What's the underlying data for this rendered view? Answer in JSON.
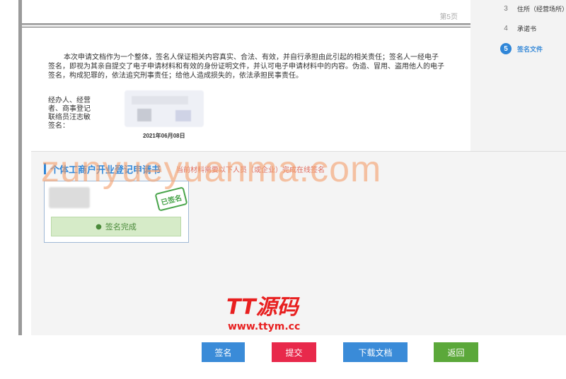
{
  "document": {
    "page_label": "第5页",
    "paragraph": "本次申请文档作为一个整体，签名人保证相关内容真实、合法、有效，并自行承担由此引起的相关责任；签名人一经电子签名，即视为其亲自提交了电子申请材料和有效的身份证明文件，并认可电子申请材料中的内容。伪造、冒用、盗用他人的电子签名，构成犯罪的，依法追究刑事责任；给他人造成损失的，依法承担民事责任。",
    "signer_label": "经办人、经营者、商事登记联络员汪志敏 签名：",
    "sign_date": "2021年06月08日"
  },
  "steps": [
    {
      "num": "3",
      "label": "住所（经营场所）"
    },
    {
      "num": "4",
      "label": "承诺书"
    },
    {
      "num": "5",
      "label": "签名文件"
    }
  ],
  "panel": {
    "title": "个体工商户开业登记申请书",
    "note": "当前材料需要以下人员（或企业）完成在线签名",
    "stamp": "已签名",
    "status": "签名完成"
  },
  "watermark": "zunyueyuanma.com",
  "brand": {
    "name": "TT源码",
    "url": "www.ttym.cc"
  },
  "buttons": {
    "sign": "签名",
    "submit": "提交",
    "download": "下载文档",
    "back": "返回"
  },
  "colors": {
    "accent": "#2f86d8",
    "submit": "#e8294b",
    "back": "#5ba83a"
  }
}
